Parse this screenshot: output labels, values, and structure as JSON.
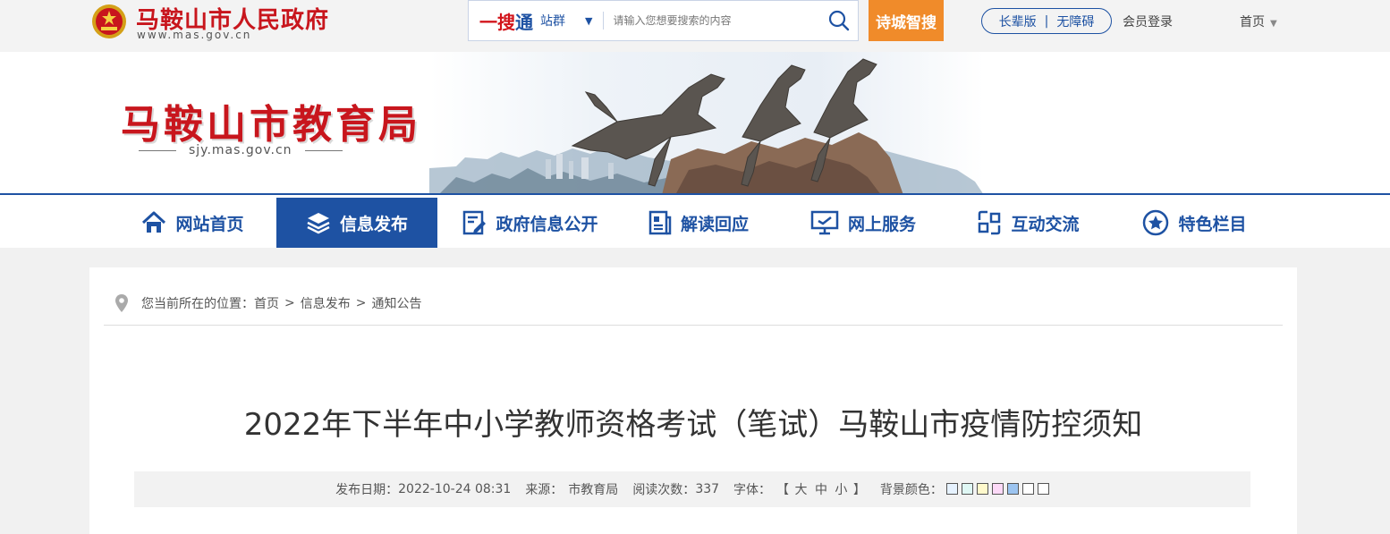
{
  "header": {
    "gov_name": "马鞍山市人民政府",
    "gov_domain": "www.mas.gov.cn",
    "search": {
      "brand_a": "一搜",
      "brand_b": "通",
      "scope": "站群",
      "scope_caret": "▼",
      "placeholder": "请输入您想要搜索的内容"
    },
    "poetry_search": "诗城智搜",
    "elder_mode": "长辈版",
    "access_sep": "|",
    "accessible": "无障碍",
    "member_login": "会员登录",
    "home_menu": "首页",
    "home_caret": "▼"
  },
  "banner": {
    "dept_name": "马鞍山市教育局",
    "dept_domain": "sjy.mas.gov.cn"
  },
  "nav": {
    "items": [
      {
        "label": "网站首页",
        "icon": "home-icon"
      },
      {
        "label": "信息发布",
        "icon": "layers-icon"
      },
      {
        "label": "政府信息公开",
        "icon": "document-edit-icon"
      },
      {
        "label": "解读回应",
        "icon": "newspaper-icon"
      },
      {
        "label": "网上服务",
        "icon": "monitor-icon"
      },
      {
        "label": "互动交流",
        "icon": "interaction-icon"
      },
      {
        "label": "特色栏目",
        "icon": "star-circle-icon"
      }
    ],
    "active_index": 1
  },
  "breadcrumb": {
    "prefix": "您当前所在的位置：",
    "items": [
      "首页",
      "信息发布",
      "通知公告"
    ],
    "sep": ">"
  },
  "article": {
    "title": "2022年下半年中小学教师资格考试（笔试）马鞍山市疫情防控须知",
    "date_label": "发布日期：",
    "date": "2022-10-24 08:31",
    "source_label": "来源：",
    "source": "市教育局",
    "views_label": "阅读次数：",
    "views": "337",
    "font_label": "字体：",
    "font_open": "【",
    "font_large": "大",
    "font_medium": "中",
    "font_small": "小",
    "font_close": "】",
    "bg_label": "背景颜色：",
    "bg_colors": [
      "#e6f2ff",
      "#dff7f4",
      "#fff9cc",
      "#fcd9f7",
      "#9cc4f0",
      "#ffffff",
      "#ffffff"
    ]
  },
  "colors": {
    "brand_blue": "#1e52a3",
    "brand_red": "#c8161d",
    "orange": "#f08b2a"
  }
}
